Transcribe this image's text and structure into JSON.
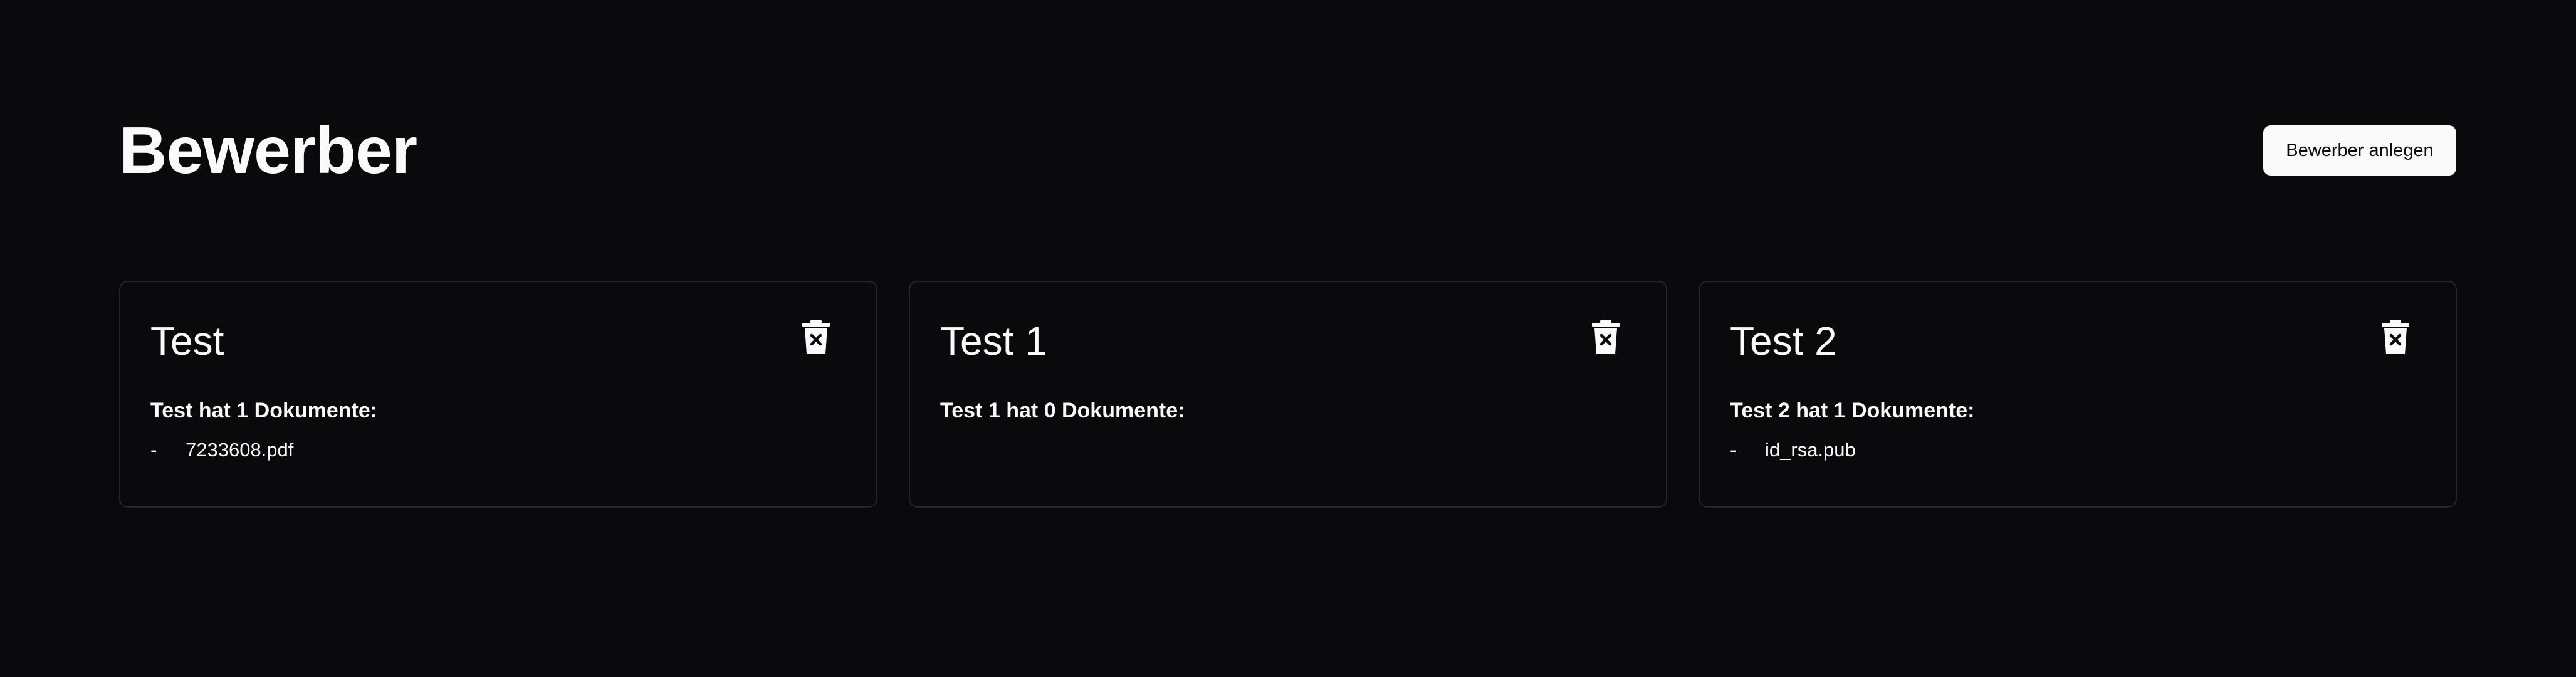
{
  "header": {
    "title": "Bewerber",
    "create_button_label": "Bewerber anlegen"
  },
  "applicants": [
    {
      "name": "Test",
      "documents_heading": "Test hat 1 Dokumente:",
      "documents": [
        "7233608.pdf"
      ]
    },
    {
      "name": "Test 1",
      "documents_heading": "Test 1 hat 0 Dokumente:",
      "documents": []
    },
    {
      "name": "Test 2",
      "documents_heading": "Test 2 hat 1 Dokumente:",
      "documents": [
        "id_rsa.pub"
      ]
    }
  ],
  "list_marker": "-",
  "icons": {
    "delete": "trash-x-icon"
  },
  "colors": {
    "background": "#0a0a0c",
    "text": "#fafafa",
    "card_border": "#27272a",
    "button_background": "#fafafa",
    "button_text": "#0a0a0c"
  }
}
